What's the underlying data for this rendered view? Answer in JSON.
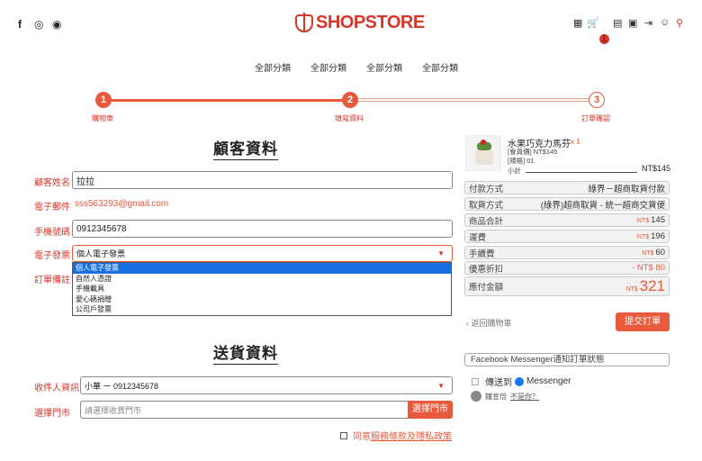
{
  "header": {
    "social_icons": [
      "facebook-icon",
      "instagram-icon",
      "line-icon"
    ],
    "logo_text": "SHOPSTORE",
    "cart_count": "1",
    "nav": [
      "全部分類",
      "全部分類",
      "全部分類",
      "全部分類"
    ]
  },
  "steps": [
    {
      "num": "1",
      "label": "購物車"
    },
    {
      "num": "2",
      "label": "填寫資料"
    },
    {
      "num": "3",
      "label": "訂單確認"
    }
  ],
  "customer": {
    "title": "顧客資料",
    "name_label": "顧客姓名",
    "name_value": "拉拉",
    "email_label": "電子郵件",
    "email_value": "sss563293@gmail.com",
    "phone_label": "手機號碼",
    "phone_value": "0912345678",
    "invoice_label": "電子發票",
    "invoice_value": "個人電子發票",
    "note_label": "訂單備註",
    "invoice_options": [
      "個人電子發票",
      "自然人憑證",
      "手機載具",
      "愛心碼捐贈",
      "公司戶發票"
    ]
  },
  "shipping": {
    "title": "送貨資料",
    "receiver_label": "收件人資訊",
    "receiver_value": "小華 ー 0912345678",
    "store_label": "選擇門市",
    "store_placeholder": "請選擇收貨門市",
    "store_button": "選擇門市",
    "agree_prefix": "同意",
    "agree_link": "服務條款及隱私政策"
  },
  "order": {
    "product_name": "水果巧克力馬芬",
    "product_qty": "x 1",
    "product_spec1": "[會員價] NT$145",
    "product_spec2": "[規格] 01",
    "subtotal_label": "小計",
    "subtotal_value": "NT$145",
    "payment_label": "付款方式",
    "payment_value": "綠界－超商取貨付款",
    "delivery_label": "取貨方式",
    "delivery_value": "(綠界)超商取貨 - 統一超商交貨便",
    "goods_total_label": "商品合計",
    "goods_total_value": "145",
    "shipping_fee_label": "運費",
    "shipping_fee_value": "196",
    "handling_label": "手續費",
    "handling_value": "60",
    "discount_label": "優惠折扣",
    "discount_value": "- NT$ 80",
    "grand_total_label": "應付金額",
    "grand_total_value": "321",
    "currency": "NT$",
    "back_link": "返回購物車",
    "submit_button": "提交訂單",
    "fb_notify": "Facebook Messenger通知訂單狀態",
    "send_to": "傳送到",
    "messenger": "Messenger",
    "user_name": "鐘宣倍",
    "not_you": "不是你？"
  },
  "colors": {
    "accent": "#e85a3c",
    "brand": "#d7372a"
  }
}
